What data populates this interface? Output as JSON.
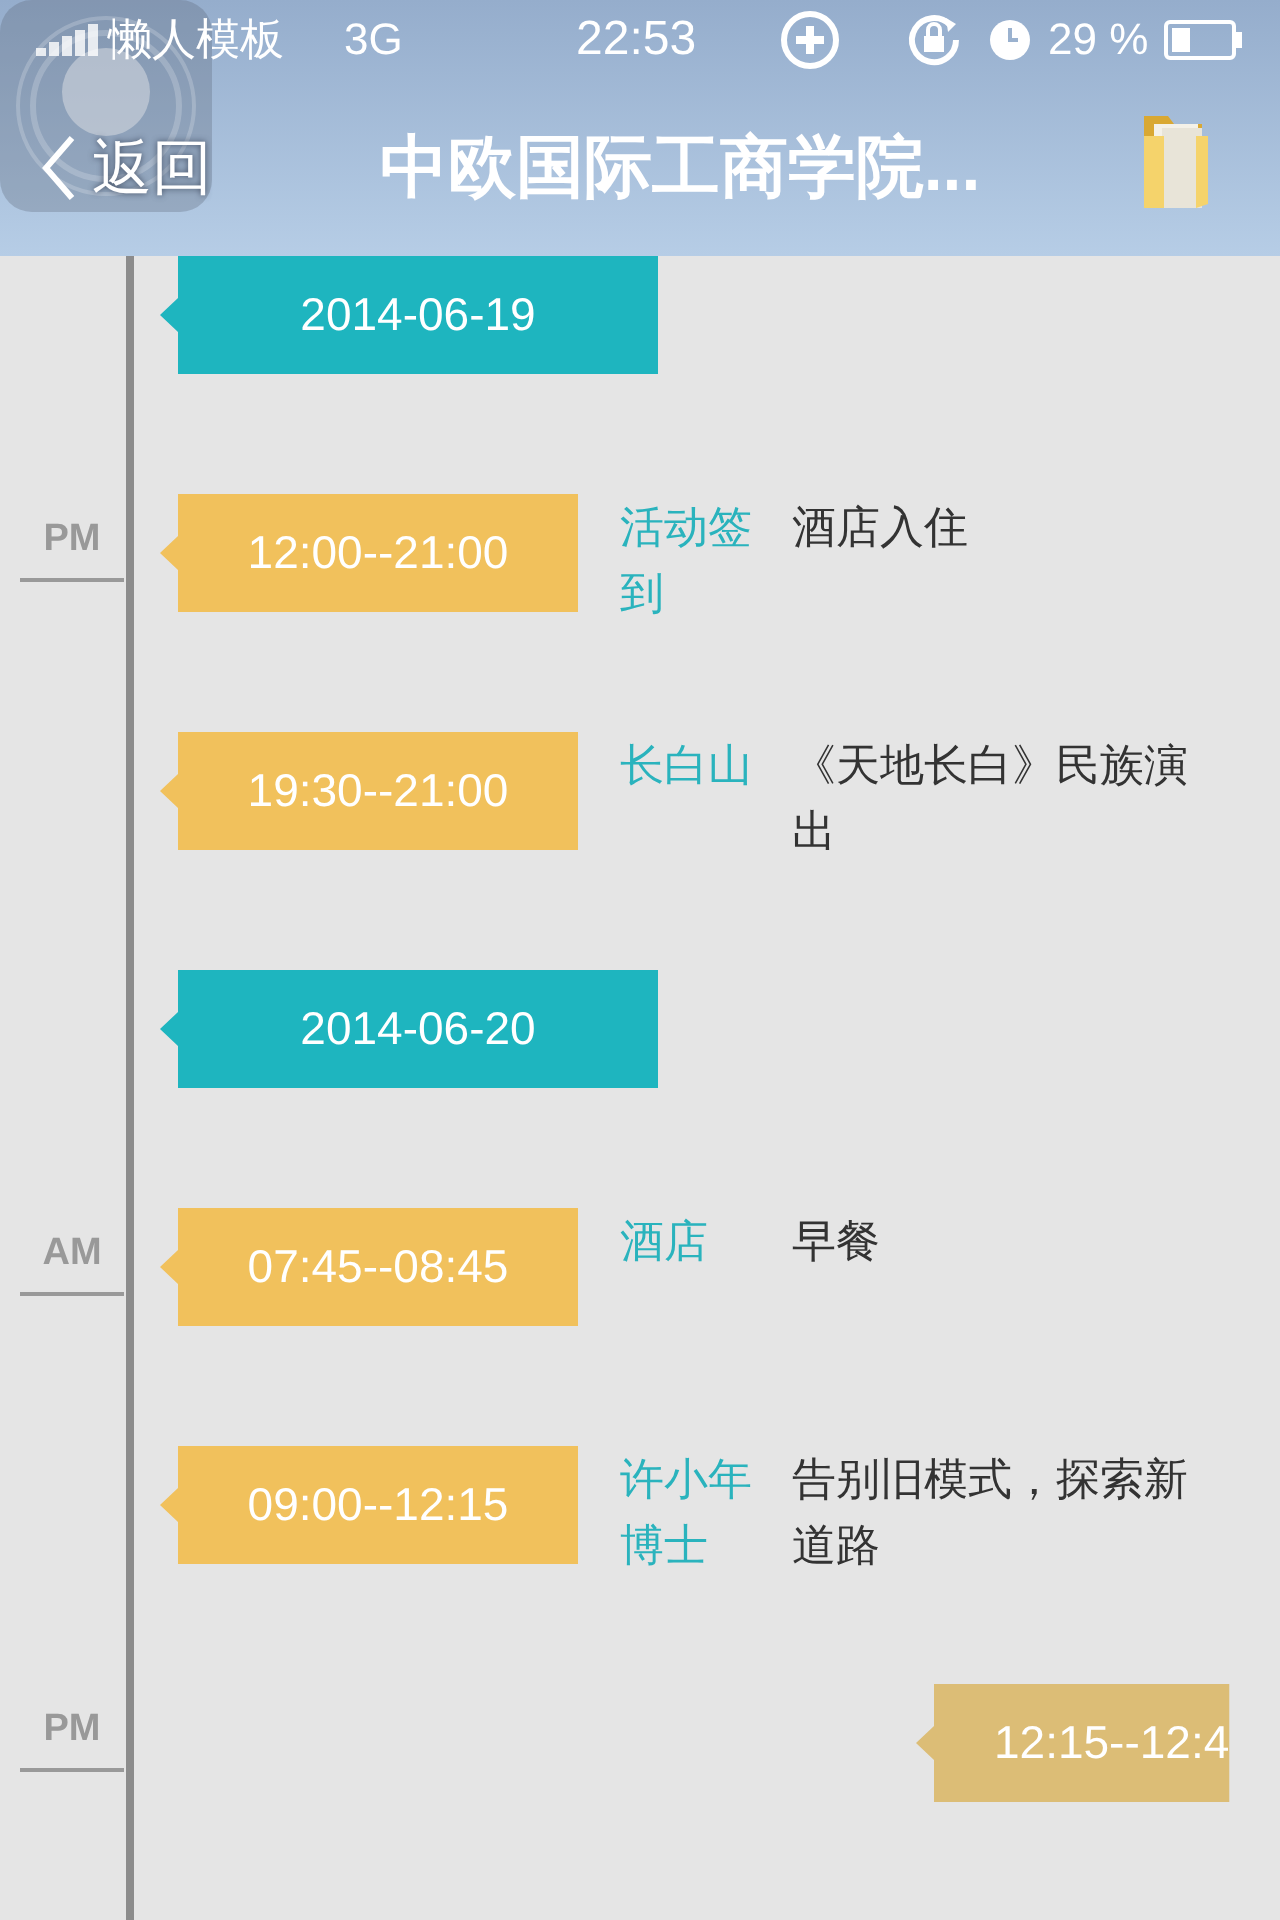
{
  "status_bar": {
    "carrier": "懒人模板",
    "network": "3G",
    "time": "22:53",
    "battery": "29 %"
  },
  "nav": {
    "back": "返回",
    "title": "中欧国际工商学院..."
  },
  "timeline": [
    {
      "kind": "date",
      "time": "2014-06-19"
    },
    {
      "kind": "event",
      "period": "PM",
      "time": "12:00--21:00",
      "place": "活动签到",
      "desc": "酒店入住"
    },
    {
      "kind": "event",
      "time": "19:30--21:00",
      "place": "长白山",
      "desc": "《天地长白》民族演出"
    },
    {
      "kind": "date",
      "time": "2014-06-20"
    },
    {
      "kind": "event",
      "period": "AM",
      "time": "07:45--08:45",
      "place": "酒店",
      "desc": "早餐"
    },
    {
      "kind": "event",
      "time": "09:00--12:15",
      "place": "许小年博士",
      "desc": "告别旧模式，探索新道路"
    },
    {
      "kind": "entering",
      "period": "PM",
      "time": "12:15--12:4"
    }
  ]
}
